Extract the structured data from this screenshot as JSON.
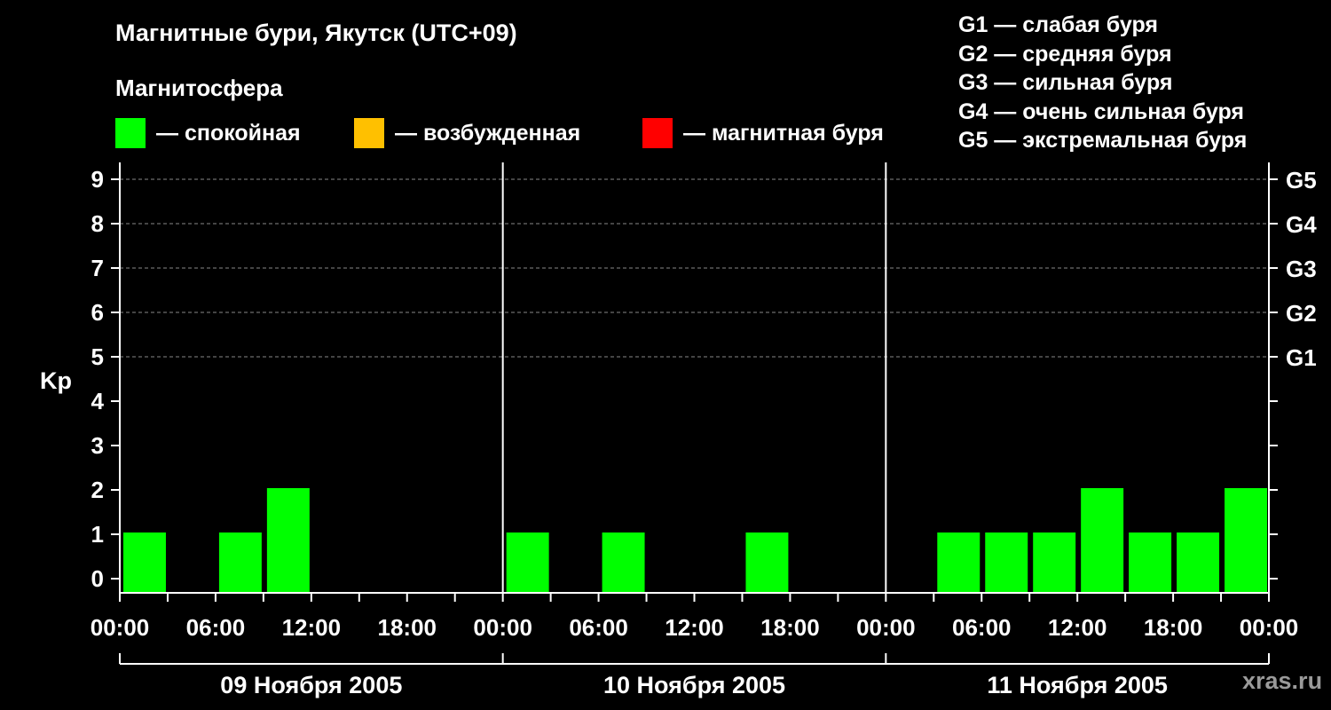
{
  "header": {
    "title": "Магнитные бури, Якутск (UTC+09)",
    "subtitle": "Магнитосфера"
  },
  "legend": [
    {
      "label": "— спокойная",
      "color": "#00ff00"
    },
    {
      "label": "— возбужденная",
      "color": "#ffc000"
    },
    {
      "label": "— магнитная буря",
      "color": "#ff0000"
    }
  ],
  "g_legend": [
    "G1 — слабая буря",
    "G2 — средняя буря",
    "G3 — сильная буря",
    "G4 — очень сильная буря",
    "G5 — экстремальная буря"
  ],
  "watermark": "xras.ru",
  "chart_data": {
    "type": "bar",
    "ylabel": "Kp",
    "ylim": [
      0,
      9
    ],
    "y_ticks": [
      "0",
      "1",
      "2",
      "3",
      "4",
      "5",
      "6",
      "7",
      "8",
      "9"
    ],
    "right_ticks": [
      {
        "value": 5,
        "label": "G1"
      },
      {
        "value": 6,
        "label": "G2"
      },
      {
        "value": 7,
        "label": "G3"
      },
      {
        "value": 8,
        "label": "G4"
      },
      {
        "value": 9,
        "label": "G5"
      }
    ],
    "x_tick_labels": [
      "00:00",
      "06:00",
      "12:00",
      "18:00",
      "00:00",
      "06:00",
      "12:00",
      "18:00",
      "00:00",
      "06:00",
      "12:00",
      "18:00",
      "00:00"
    ],
    "days": [
      "09 Ноября 2005",
      "10 Ноября 2005",
      "11 Ноября 2005"
    ],
    "interval_hours": 3,
    "values": [
      1,
      0,
      1,
      2,
      0,
      0,
      0,
      0,
      1,
      0,
      1,
      0,
      0,
      1,
      0,
      0,
      0,
      1,
      1,
      1,
      2,
      1,
      1,
      2
    ],
    "colors": {
      "quiet": "#00ff00",
      "active": "#ffc000",
      "storm": "#ff0000"
    },
    "grid": "dashed at 5–9"
  }
}
